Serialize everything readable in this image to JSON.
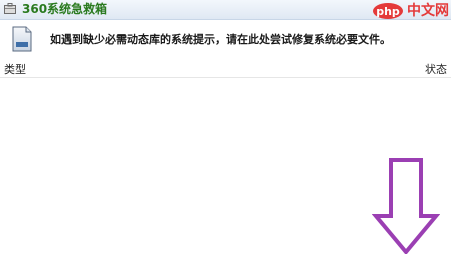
{
  "window": {
    "title": "360系统急救箱"
  },
  "watermark": {
    "logo_text": "php",
    "text": "中文网"
  },
  "info": {
    "message": "如遇到缺少必需动态库的系统提示，请在此处尝试修复系统必要文件。"
  },
  "table": {
    "columns": [
      "类型",
      "状态"
    ],
    "rows": []
  },
  "colors": {
    "title_green": "#2a7a1f",
    "watermark_red": "#e43a3a",
    "arrow_purple": "#9b3fb3"
  },
  "icons": {
    "app": "toolbox-icon",
    "info": "document-icon",
    "annotation": "arrow-down-icon"
  }
}
